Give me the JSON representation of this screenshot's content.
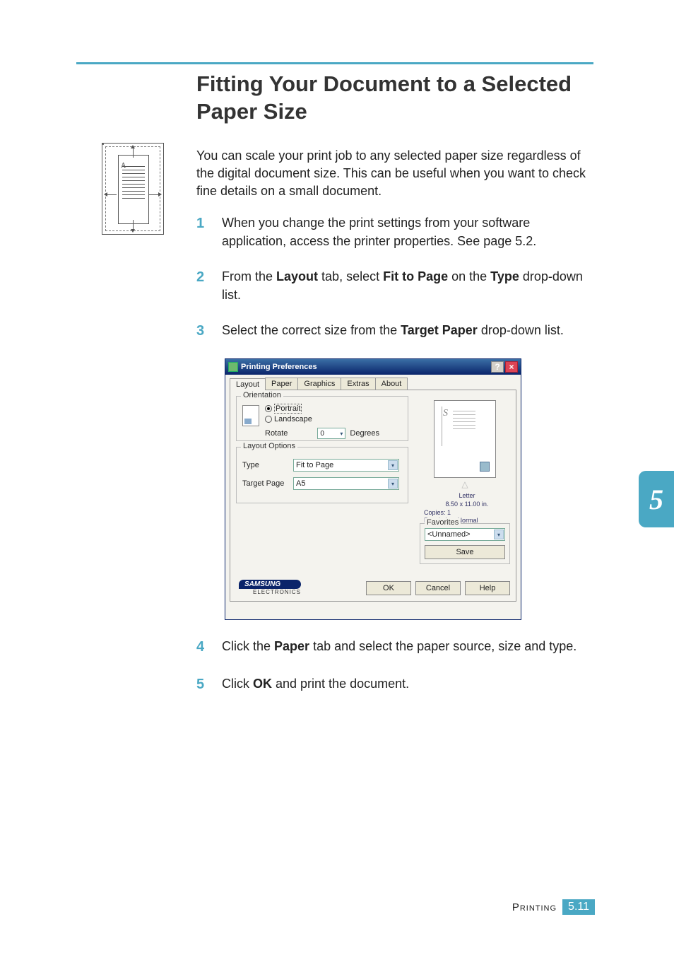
{
  "title": "Fitting Your Document to a Selected Paper Size",
  "intro": "You can scale your print job to any selected paper size regardless of the digital document size. This can be useful when you want to check fine details on a small document.",
  "side_fig_letter": "A",
  "steps": {
    "s1_num": "1",
    "s1_a": "When you change the print settings from your software application, access the printer properties. See page 5.2.",
    "s2_num": "2",
    "s2_a": "From the ",
    "s2_b": "Layout",
    "s2_c": " tab, select ",
    "s2_d": "Fit to Page",
    "s2_e": " on the ",
    "s2_f": "Type",
    "s2_g": " drop-down list.",
    "s3_num": "3",
    "s3_a": "Select the correct size from the ",
    "s3_b": "Target Paper",
    "s3_c": " drop-down list.",
    "s4_num": "4",
    "s4_a": "Click the ",
    "s4_b": "Paper",
    "s4_c": " tab and select the paper source, size and type.",
    "s5_num": "5",
    "s5_a": "Click ",
    "s5_b": "OK",
    "s5_c": " and print the document."
  },
  "dialog": {
    "title": "Printing Preferences",
    "help_btn": "?",
    "close_btn": "×",
    "tabs": {
      "layout": "Layout",
      "paper": "Paper",
      "graphics": "Graphics",
      "extras": "Extras",
      "about": "About"
    },
    "orientation": {
      "label": "Orientation",
      "portrait": "Portrait",
      "landscape": "Landscape",
      "rotate": "Rotate",
      "rotate_val": "0",
      "degrees": "Degrees"
    },
    "layout_options": {
      "label": "Layout Options",
      "type_label": "Type",
      "type_value": "Fit to Page",
      "target_label": "Target Page",
      "target_value": "A5"
    },
    "preview": {
      "s": "S",
      "paper": "Letter",
      "dims": "8.50 x 11.00 in.",
      "copies": "Copies: 1",
      "resolution": "Resolution: Normal"
    },
    "favorites": {
      "label": "Favorites",
      "value": "<Unnamed>",
      "save": "Save"
    },
    "logo_brand": "SAMSUNG",
    "logo_sub": "ELECTRONICS",
    "buttons": {
      "ok": "OK",
      "cancel": "Cancel",
      "help": "Help"
    }
  },
  "chapter": "5",
  "footer": {
    "label": "Printing",
    "page": "5.11"
  }
}
